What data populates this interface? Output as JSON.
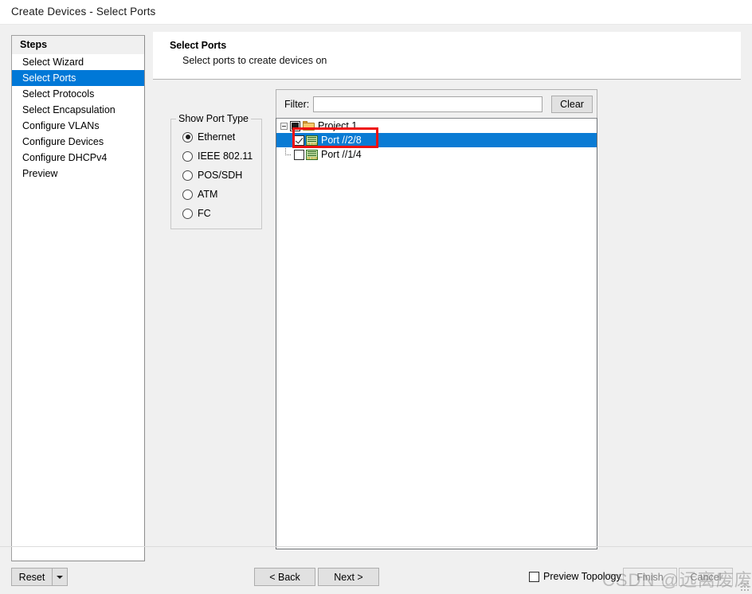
{
  "window": {
    "title": "Create Devices - Select Ports"
  },
  "sidebar": {
    "header": "Steps",
    "items": [
      {
        "label": "Select Wizard",
        "selected": false
      },
      {
        "label": "Select Ports",
        "selected": true
      },
      {
        "label": "Select Protocols",
        "selected": false
      },
      {
        "label": "Select Encapsulation",
        "selected": false
      },
      {
        "label": "Configure VLANs",
        "selected": false
      },
      {
        "label": "Configure Devices",
        "selected": false
      },
      {
        "label": "Configure DHCPv4",
        "selected": false
      },
      {
        "label": "Preview",
        "selected": false
      }
    ]
  },
  "header": {
    "title": "Select Ports",
    "subtitle": "Select ports to create devices on"
  },
  "port_type": {
    "legend": "Show Port Type",
    "options": [
      {
        "label": "Ethernet",
        "checked": true
      },
      {
        "label": "IEEE 802.11",
        "checked": false
      },
      {
        "label": "POS/SDH",
        "checked": false
      },
      {
        "label": "ATM",
        "checked": false
      },
      {
        "label": "FC",
        "checked": false
      }
    ]
  },
  "filter": {
    "label": "Filter:",
    "value": "",
    "placeholder": "",
    "clear_label": "Clear"
  },
  "tree": {
    "root": {
      "label": "Project 1",
      "icon": "folder-icon",
      "check_state": "partial",
      "expanded": true
    },
    "children": [
      {
        "label": "Port //2/8",
        "icon": "port-icon",
        "check_state": "checked",
        "selected": true,
        "annotated": true
      },
      {
        "label": "Port //1/4",
        "icon": "port-icon",
        "check_state": "unchecked",
        "selected": false,
        "annotated": false
      }
    ]
  },
  "footer": {
    "reset_label": "Reset",
    "back_label": "< Back",
    "next_label": "Next >",
    "finish_label": "Finish",
    "cancel_label": "Cancel",
    "preview_topology_label": "Preview Topology",
    "preview_topology_checked": false
  },
  "watermark": {
    "text": "CSDN @远离废废"
  },
  "colors": {
    "selection_blue": "#0078d7",
    "tree_selection_blue": "#0a7bd4",
    "annotation_red": "#ee1111",
    "panel_gray": "#f0f0f0",
    "button_face": "#e1e1e1"
  }
}
